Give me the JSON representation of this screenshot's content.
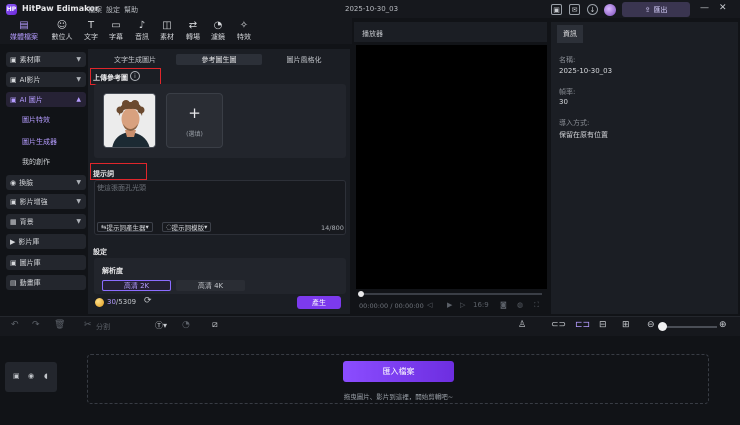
{
  "titlebar": {
    "app_title": "HitPaw Edimakor",
    "menu": [
      "檔案",
      "設定",
      "幫助"
    ],
    "project_title": "2025-10-30_03",
    "export_label": "匯出"
  },
  "tool_tabs": [
    {
      "label": "媒體檔案",
      "icon": "media-icon",
      "active": true
    },
    {
      "label": "數位人",
      "icon": "avatar-person-icon"
    },
    {
      "label": "文字",
      "icon": "text-icon"
    },
    {
      "label": "字幕",
      "icon": "subtitle-icon"
    },
    {
      "label": "音訊",
      "icon": "music-note-icon"
    },
    {
      "label": "素材",
      "icon": "sticker-icon"
    },
    {
      "label": "轉場",
      "icon": "transition-icon"
    },
    {
      "label": "濾鏡",
      "icon": "filter-icon"
    },
    {
      "label": "特效",
      "icon": "effects-icon"
    }
  ],
  "left_nav": {
    "items": [
      {
        "label": "素材庫"
      },
      {
        "label": "AI影片"
      },
      {
        "label": "AI 圖片",
        "active": true
      },
      {
        "label": "換臉"
      },
      {
        "label": "影片增強"
      },
      {
        "label": "背景"
      },
      {
        "label": "影片庫"
      },
      {
        "label": "圖片庫"
      },
      {
        "label": "動畫庫"
      }
    ],
    "subitems": [
      {
        "label": "圖片特效"
      },
      {
        "label": "圖片生成器",
        "active": true
      },
      {
        "label": "我的創作"
      }
    ]
  },
  "generator": {
    "subtabs": [
      "文字生成圖片",
      "參考圖生圖",
      "圖片風格化"
    ],
    "active_subtab": "參考圖生圖",
    "upload_title": "上傳參考圖",
    "add_label": "(選填)",
    "prompt_title": "提示詞",
    "prompt_placeholder": "使這張面孔光頭",
    "prompt_generator_label": "提示詞產生器",
    "prompt_library_label": "提示詞模版",
    "char_count": "14/800",
    "settings_title": "設定",
    "resolution_title": "解析度",
    "resolutions": [
      "高清 2K",
      "高清 4K"
    ],
    "selected_resolution": "高清 2K",
    "credits_used": "30",
    "credits_total": "/5309",
    "generate_label": "產生"
  },
  "player": {
    "title": "播放器",
    "timecode": "00:00:00 / 00:00:00",
    "aspect": "16:9",
    "progress": 0
  },
  "info_panel": {
    "tab": "資訊",
    "fields": [
      {
        "label": "名稱:",
        "value": "2025-10-30_03"
      },
      {
        "label": "幀率:",
        "value": "30"
      },
      {
        "label": "導入方式:",
        "value": "保留在原有位置"
      }
    ]
  },
  "timeline": {
    "split_label": "分割",
    "import_label": "匯入檔案",
    "drop_hint": "拖曳圖片、影片到這裡，開始剪輯吧~",
    "zoom_level": 0.05
  },
  "colors": {
    "accent": "#7c3aed",
    "accent_text": "#b59cff",
    "highlight_box": "#e0262b",
    "background": "#111317"
  }
}
